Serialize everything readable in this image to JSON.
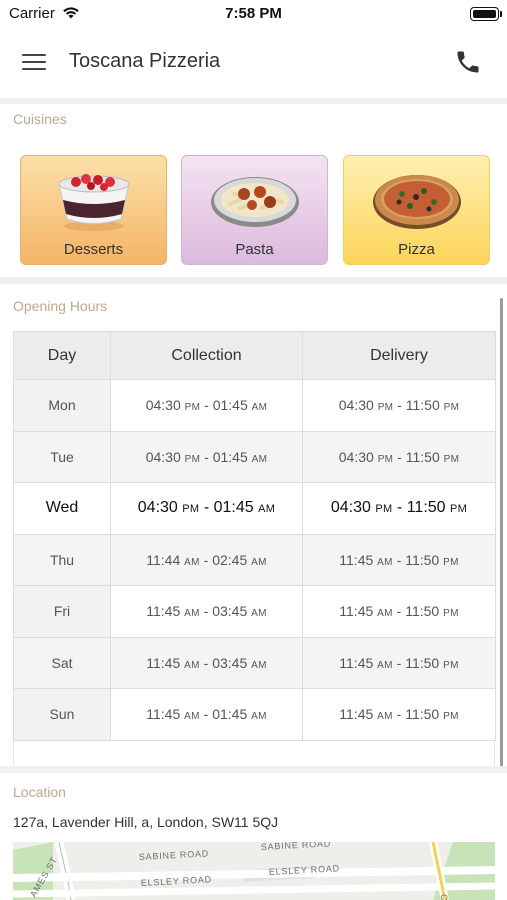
{
  "status_bar": {
    "carrier": "Carrier",
    "time": "7:58 PM"
  },
  "app_bar": {
    "title": "Toscana Pizzeria"
  },
  "cuisines": {
    "heading": "Cuisines",
    "items": [
      {
        "label": "Desserts"
      },
      {
        "label": "Pasta"
      },
      {
        "label": "Pizza"
      }
    ]
  },
  "opening_hours": {
    "heading": "Opening Hours",
    "columns": [
      "Day",
      "Collection",
      "Delivery"
    ],
    "rows": [
      {
        "day": "Mon",
        "collection": {
          "start": "04:30",
          "start_ampm": "PM",
          "end": "01:45",
          "end_ampm": "AM"
        },
        "delivery": {
          "start": "04:30",
          "start_ampm": "PM",
          "end": "11:50",
          "end_ampm": "PM"
        }
      },
      {
        "day": "Tue",
        "collection": {
          "start": "04:30",
          "start_ampm": "PM",
          "end": "01:45",
          "end_ampm": "AM"
        },
        "delivery": {
          "start": "04:30",
          "start_ampm": "PM",
          "end": "11:50",
          "end_ampm": "PM"
        }
      },
      {
        "day": "Wed",
        "collection": {
          "start": "04:30",
          "start_ampm": "PM",
          "end": "01:45",
          "end_ampm": "AM"
        },
        "delivery": {
          "start": "04:30",
          "start_ampm": "PM",
          "end": "11:50",
          "end_ampm": "PM"
        }
      },
      {
        "day": "Thu",
        "collection": {
          "start": "11:44",
          "start_ampm": "AM",
          "end": "02:45",
          "end_ampm": "AM"
        },
        "delivery": {
          "start": "11:45",
          "start_ampm": "AM",
          "end": "11:50",
          "end_ampm": "PM"
        }
      },
      {
        "day": "Fri",
        "collection": {
          "start": "11:45",
          "start_ampm": "AM",
          "end": "03:45",
          "end_ampm": "AM"
        },
        "delivery": {
          "start": "11:45",
          "start_ampm": "AM",
          "end": "11:50",
          "end_ampm": "PM"
        }
      },
      {
        "day": "Sat",
        "collection": {
          "start": "11:45",
          "start_ampm": "AM",
          "end": "03:45",
          "end_ampm": "AM"
        },
        "delivery": {
          "start": "11:45",
          "start_ampm": "AM",
          "end": "11:50",
          "end_ampm": "PM"
        }
      },
      {
        "day": "Sun",
        "collection": {
          "start": "11:45",
          "start_ampm": "AM",
          "end": "01:45",
          "end_ampm": "AM"
        },
        "delivery": {
          "start": "11:45",
          "start_ampm": "AM",
          "end": "11:50",
          "end_ampm": "PM"
        }
      }
    ]
  },
  "location": {
    "heading": "Location",
    "address": "127a, Lavender Hill, a, London, SW11 5QJ",
    "map_labels": {
      "sabine_1": "SABINE ROAD",
      "sabine_2": "SABINE ROAD",
      "elsley_1": "ELSLEY ROAD",
      "elsley_2": "ELSLEY ROAD",
      "james_st": "AMES ST",
      "ce": "CE"
    }
  },
  "icons": {
    "menu": "hamburger-menu-icon",
    "phone": "phone-icon",
    "wifi": "wifi-icon",
    "battery": "battery-icon"
  },
  "colors": {
    "section_label": "#bda88a",
    "desserts_tile": "#f4b468",
    "pasta_tile": "#dcb9dc",
    "pizza_tile": "#fbd55a"
  }
}
